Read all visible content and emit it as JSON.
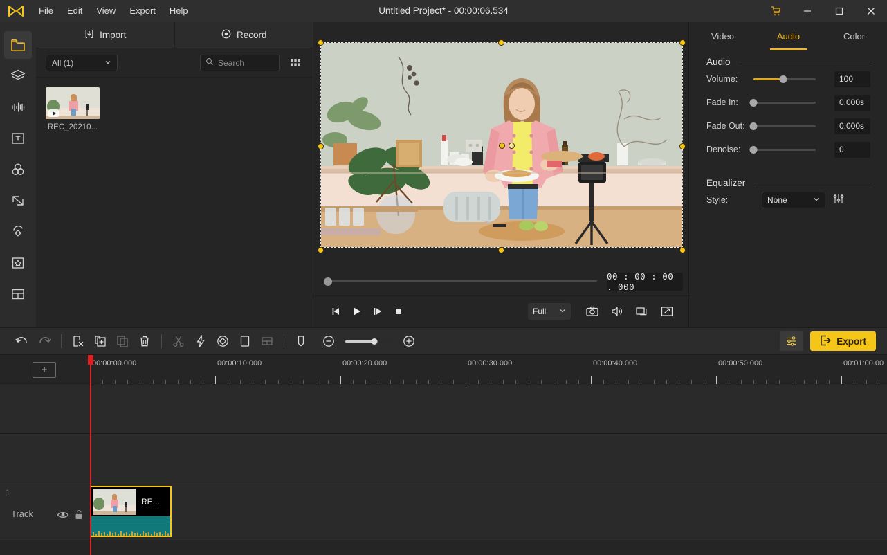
{
  "window": {
    "title": "Untitled Project* - 00:00:06.534",
    "logo_icon": "app-logo-icon",
    "menus": [
      "File",
      "Edit",
      "View",
      "Export",
      "Help"
    ],
    "controls": {
      "cart_icon": "shopping-cart-icon",
      "minimize_icon": "minimize-icon",
      "maximize_icon": "maximize-icon",
      "close_icon": "close-icon"
    }
  },
  "rail": {
    "items": [
      {
        "icon": "media-folder-icon",
        "name": "media",
        "active": true
      },
      {
        "icon": "layers-stack-icon",
        "name": "overlays",
        "active": false
      },
      {
        "icon": "audio-waveform-icon",
        "name": "audio",
        "active": false
      },
      {
        "icon": "text-box-icon",
        "name": "text",
        "active": false
      },
      {
        "icon": "color-filters-icon",
        "name": "filters",
        "active": false
      },
      {
        "icon": "transition-arrows-icon",
        "name": "transitions",
        "active": false
      },
      {
        "icon": "rotate-shape-icon",
        "name": "animation",
        "active": false
      },
      {
        "icon": "star-frame-icon",
        "name": "elements",
        "active": false
      },
      {
        "icon": "split-layout-icon",
        "name": "split-screen",
        "active": false
      }
    ]
  },
  "media": {
    "tabs": [
      {
        "label": "Import",
        "icon": "import-download-icon"
      },
      {
        "label": "Record",
        "icon": "record-dot-icon"
      }
    ],
    "filter": {
      "value": "All (1)",
      "chevron_icon": "chevron-down-icon"
    },
    "search": {
      "placeholder": "Search",
      "value": "",
      "icon": "search-icon"
    },
    "view_toggle_icon": "grid-view-icon",
    "items": [
      {
        "name": "REC_20210...",
        "badge_icon": "play-badge-icon"
      }
    ]
  },
  "preview": {
    "selection_handles": 9,
    "scrubber": {
      "position_percent": 0
    },
    "timecode": "00 : 00 : 00 . 000",
    "transport": [
      {
        "name": "prev-frame-button",
        "icon": "step-backward-icon"
      },
      {
        "name": "play-button",
        "icon": "play-icon"
      },
      {
        "name": "next-frame-button",
        "icon": "step-forward-icon"
      },
      {
        "name": "stop-button",
        "icon": "stop-icon"
      }
    ],
    "quality": {
      "value": "Full",
      "chevron_icon": "chevron-down-icon"
    },
    "right_tools": [
      {
        "name": "snapshot-button",
        "icon": "camera-icon"
      },
      {
        "name": "volume-button",
        "icon": "speaker-icon"
      },
      {
        "name": "compare-button",
        "icon": "windows-overlap-icon"
      },
      {
        "name": "fullscreen-button",
        "icon": "expand-arrows-icon"
      }
    ]
  },
  "props": {
    "tabs": [
      {
        "label": "Video",
        "active": false
      },
      {
        "label": "Audio",
        "active": true
      },
      {
        "label": "Color",
        "active": false
      }
    ],
    "audio_section": {
      "title": "Audio",
      "rows": [
        {
          "label": "Volume:",
          "value": "100",
          "slider_percent": 48,
          "accent": true
        },
        {
          "label": "Fade In:",
          "value": "0.000s",
          "slider_percent": 0,
          "accent": false
        },
        {
          "label": "Fade Out:",
          "value": "0.000s",
          "slider_percent": 0,
          "accent": false
        },
        {
          "label": "Denoise:",
          "value": "0",
          "slider_percent": 0,
          "accent": false
        }
      ]
    },
    "equalizer_section": {
      "title": "Equalizer",
      "style_label": "Style:",
      "style_value": "None",
      "chevron_icon": "chevron-down-icon",
      "eq_settings_icon": "equalizer-sliders-icon"
    },
    "accent_color": "#f0b728"
  },
  "toolbar": {
    "groups": [
      [
        {
          "name": "undo-button",
          "icon": "undo-arrow-icon",
          "enabled": true
        },
        {
          "name": "redo-button",
          "icon": "redo-arrow-icon",
          "enabled": false
        }
      ],
      [
        {
          "name": "split-cut-button",
          "icon": "cut-page-icon",
          "enabled": true
        },
        {
          "name": "add-clip-button",
          "icon": "copy-plus-icon",
          "enabled": true
        },
        {
          "name": "duplicate-button",
          "icon": "copy-icon",
          "enabled": false
        },
        {
          "name": "delete-button",
          "icon": "trash-icon",
          "enabled": true
        }
      ],
      [
        {
          "name": "scissors-button",
          "icon": "scissors-icon",
          "enabled": false
        },
        {
          "name": "speed-button",
          "icon": "lightning-icon",
          "enabled": true
        },
        {
          "name": "keyframe-button",
          "icon": "diamond-icon",
          "enabled": true
        },
        {
          "name": "crop-button",
          "icon": "crop-square-icon",
          "enabled": true
        },
        {
          "name": "mosaic-button",
          "icon": "mosaic-grid-icon",
          "enabled": false
        }
      ],
      [
        {
          "name": "marker-button",
          "icon": "bookmark-icon",
          "enabled": true
        }
      ]
    ],
    "zoom_out_icon": "zoom-out-circle-icon",
    "zoom_in_icon": "zoom-in-circle-icon",
    "zoom_percent": 62,
    "settings_icon": "sliders-settings-icon",
    "export_label": "Export",
    "export_icon": "export-arrow-icon",
    "export_color": "#f5c518"
  },
  "timeline": {
    "add_track_icon": "plus-icon",
    "ruler_labels": [
      "00:00:00.000",
      "00:00:10.000",
      "00:00:20.000",
      "00:00:30.000",
      "00:00:40.000",
      "00:00:50.000",
      "00:01:00.00"
    ],
    "ruler_spacing_px": 181,
    "playhead_position": "00:00:00.000",
    "tracks": [
      {
        "number": "",
        "label": "",
        "clips": []
      },
      {
        "number": "",
        "label": "",
        "clips": []
      },
      {
        "number": "1",
        "label": "Track",
        "eye_icon": "eye-icon",
        "lock_icon": "unlock-icon",
        "clips": [
          {
            "title": "RE...",
            "selected": true
          }
        ]
      }
    ]
  }
}
